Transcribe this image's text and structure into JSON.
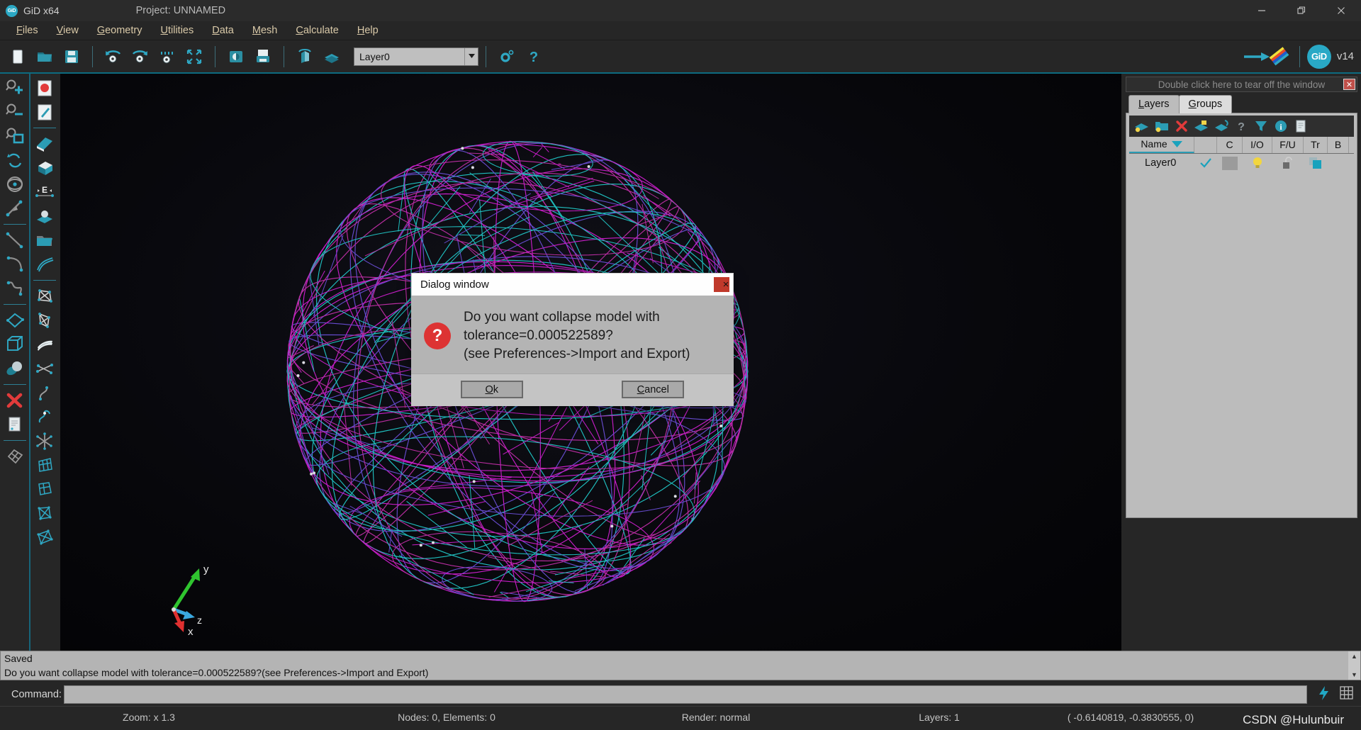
{
  "window": {
    "app_title": "GiD x64",
    "project_title": "Project: UNNAMED",
    "logo_text": "GiD",
    "minimize_icon": "minimize-icon",
    "maximize_icon": "maximize-icon",
    "close_icon": "close-icon"
  },
  "menubar": {
    "items": [
      {
        "label": "Files",
        "accel": "F"
      },
      {
        "label": "View",
        "accel": "V"
      },
      {
        "label": "Geometry",
        "accel": "G"
      },
      {
        "label": "Utilities",
        "accel": "U"
      },
      {
        "label": "Data",
        "accel": "D"
      },
      {
        "label": "Mesh",
        "accel": "M"
      },
      {
        "label": "Calculate",
        "accel": "C"
      },
      {
        "label": "Help",
        "accel": "H"
      }
    ]
  },
  "toolbar": {
    "buttons": [
      {
        "name": "new-file-icon"
      },
      {
        "name": "open-file-icon"
      },
      {
        "name": "save-file-icon"
      },
      {
        "name": "zoom-previous-icon"
      },
      {
        "name": "zoom-redo-icon"
      },
      {
        "name": "zoom-frame-icon"
      },
      {
        "name": "zoom-fit-icon"
      },
      {
        "name": "print-image-icon"
      },
      {
        "name": "print-icon"
      },
      {
        "name": "rotate-view-icon"
      },
      {
        "name": "layers-icon"
      }
    ],
    "layer_combo_value": "Layer0",
    "settings_icon": "gear-icon",
    "help_icon": "question-icon",
    "colors_icon": "color-ramp-icon",
    "version_label": "v14",
    "gid_badge": "GiD"
  },
  "left_toolbar": {
    "column_one": [
      "zoom-in-icon",
      "zoom-out-icon",
      "zoom-window-icon",
      "rotate-trackball-icon",
      "pan-icon",
      "redraw-arrow-icon",
      "line-icon",
      "arc-icon",
      "spline-icon",
      "surface-nurbs-icon",
      "volume-box-icon",
      "object-sphere-icon",
      "delete-x-icon",
      "list-entities-icon",
      "mesh-quad-icon"
    ],
    "column_two": [
      "record-icon",
      "annotate-icon",
      "create-surface-icon",
      "create-volume-icon",
      "edit-entity-icon",
      "object-on-surface-icon",
      "open-folder-icon",
      "contour-icon",
      "surface-mesh-icon",
      "nurbs-surface-icon",
      "layered-surface-icon",
      "intersect-icon",
      "curve-edit-icon",
      "split-curve-icon",
      "star-join-icon",
      "mesh-surface-icon",
      "mesh-volume-icon",
      "mesh-edit-icon",
      "mesh-generate-icon"
    ]
  },
  "right_panel": {
    "tearoff_hint": "Double click here to tear off the window",
    "close_icon": "close-panel-icon",
    "tabs": [
      {
        "label": "Layers",
        "accel": "L",
        "active": true
      },
      {
        "label": "Groups",
        "accel": "G",
        "active": false
      }
    ],
    "panel_tools": [
      "new-layer-icon",
      "new-layer-folder-icon",
      "delete-layer-icon",
      "send-to-layer-icon",
      "layer-to-front-icon",
      "layer-help-icon",
      "filter-icon",
      "info-icon",
      "layer-report-icon"
    ],
    "columns": [
      {
        "key": "name",
        "label": "Name",
        "sort_icon": "sort-descending-icon"
      },
      {
        "key": "check",
        "label": ""
      },
      {
        "key": "c",
        "label": "C"
      },
      {
        "key": "io",
        "label": "I/O"
      },
      {
        "key": "fu",
        "label": "F/U"
      },
      {
        "key": "tr",
        "label": "Tr"
      },
      {
        "key": "b",
        "label": "B"
      },
      {
        "key": "pad",
        "label": ""
      }
    ],
    "rows": [
      {
        "name": "Layer0",
        "check": "checkmark-icon",
        "color_swatch": "#9b9b9b",
        "io": "lightbulb-on-icon",
        "fu": "unlocked-icon",
        "tr": "transparency-icon",
        "b": ""
      }
    ]
  },
  "dialog": {
    "title": "Dialog window",
    "close_label": "×",
    "icon": "question-mark-icon",
    "message": "Do you want collapse model with tolerance=0.000522589?\n(see Preferences->Import and Export)",
    "buttons": [
      {
        "label": "Ok",
        "accel": "O",
        "name": "ok-button"
      },
      {
        "label": "Cancel",
        "accel": "C",
        "name": "cancel-button"
      }
    ]
  },
  "messages": {
    "line1": "Saved",
    "line2": "Do you want collapse model with tolerance=0.000522589?(see Preferences->Import and Export)"
  },
  "command": {
    "label": "Command:",
    "value": "",
    "placeholder": "",
    "run_icon": "lightning-icon",
    "grid_icon": "grid-icon"
  },
  "statusbar": {
    "zoom": "Zoom: x 1.3",
    "counts": "Nodes: 0, Elements: 0",
    "render": "Render: normal",
    "layers": "Layers: 1",
    "coords": "( -0.6140819, -0.3830555,  0)"
  },
  "watermark": "CSDN @Hulunbuir",
  "viewport": {
    "background_color": "#07070b",
    "wire_colors": [
      "#d11fd1",
      "#21c8c8",
      "#6b4fd8",
      "#c22fa8"
    ],
    "axis": {
      "x_label": "x",
      "y_label": "y",
      "z_label": "z",
      "x_color": "#e03030",
      "y_color": "#2fc42f",
      "z_color": "#3aa8e0"
    }
  }
}
